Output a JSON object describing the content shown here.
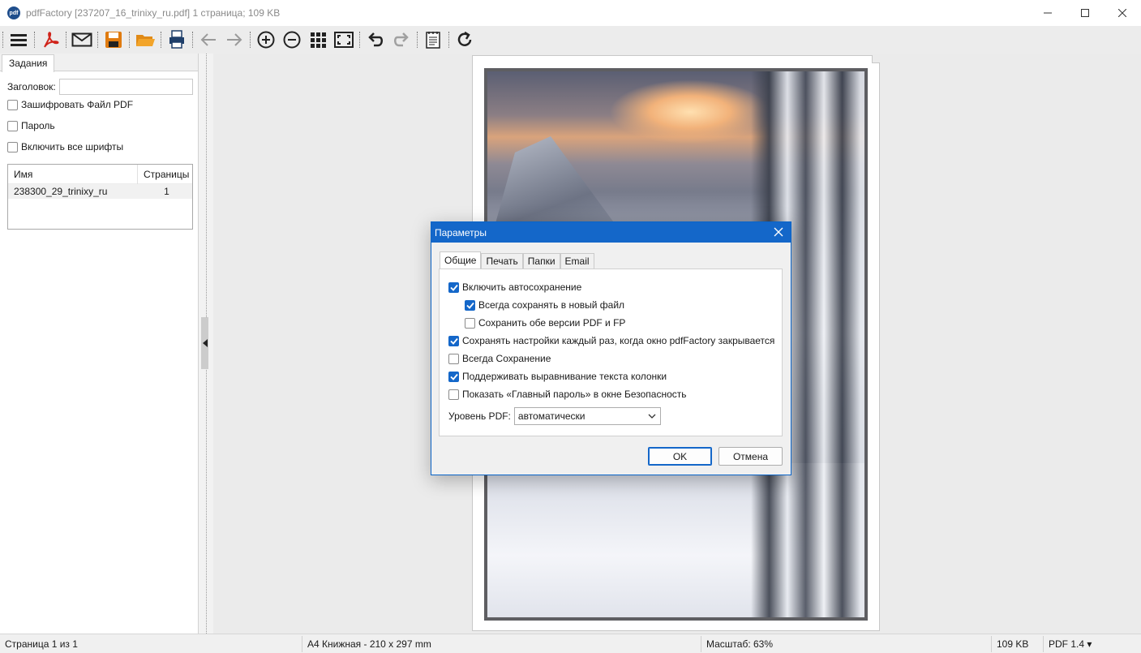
{
  "window": {
    "app_icon_text": "pdf",
    "title": "pdfFactory [237207_16_trinixy_ru.pdf] 1 страница; 109 KB"
  },
  "toolbar": {
    "icons": [
      "menu-icon",
      "pdf-icon",
      "mail-icon",
      "save-icon",
      "open-folder-icon",
      "print-icon",
      "back-arrow-icon",
      "forward-arrow-icon",
      "zoom-in-icon",
      "zoom-out-icon",
      "grid-icon",
      "fit-page-icon",
      "undo-icon",
      "redo-icon",
      "notes-icon",
      "refresh-icon"
    ]
  },
  "left_panel": {
    "tab_label": "Задания",
    "title_label": "Заголовок:",
    "title_value": "",
    "encrypt_label": "Зашифровать Файл PDF",
    "password_label": "Пароль",
    "embed_fonts_label": "Включить все шрифты",
    "jobs_table": {
      "headers": [
        "Имя",
        "Страницы"
      ],
      "rows": [
        {
          "name": "238300_29_trinixy_ru",
          "pages": "1"
        }
      ]
    }
  },
  "dialog": {
    "title": "Параметры",
    "tabs": [
      "Общие",
      "Печать",
      "Папки",
      "Email"
    ],
    "active_tab": "Общие",
    "options": [
      {
        "label": "Включить автосохранение",
        "checked": true
      },
      {
        "label": "Всегда сохранять в новый файл",
        "checked": true
      },
      {
        "label": "Сохранить обе версии PDF и FP",
        "checked": false
      },
      {
        "label": "Сохранять настройки каждый раз, когда окно pdfFactory закрывается",
        "checked": true
      },
      {
        "label": "Всегда Сохранение",
        "checked": false
      },
      {
        "label": "Поддерживать выравнивание текста колонки",
        "checked": true
      },
      {
        "label": "Показать «Главный пароль» в окне Безопасность",
        "checked": false
      }
    ],
    "pdf_level_label": "Уровень PDF:",
    "pdf_level_value": "автоматически",
    "ok_label": "OK",
    "cancel_label": "Отмена"
  },
  "statusbar": {
    "page": "Страница 1 из 1",
    "paper": "A4 Книжная - 210 x 297 mm",
    "zoom": "Масштаб: 63%",
    "size": "109 KB",
    "pdf_version": "PDF 1.4 ▾"
  },
  "colors": {
    "accent": "#1467c9",
    "toolbar_bg": "#ececec",
    "pdf_red": "#d0241b",
    "save_orange": "#e07b10"
  }
}
